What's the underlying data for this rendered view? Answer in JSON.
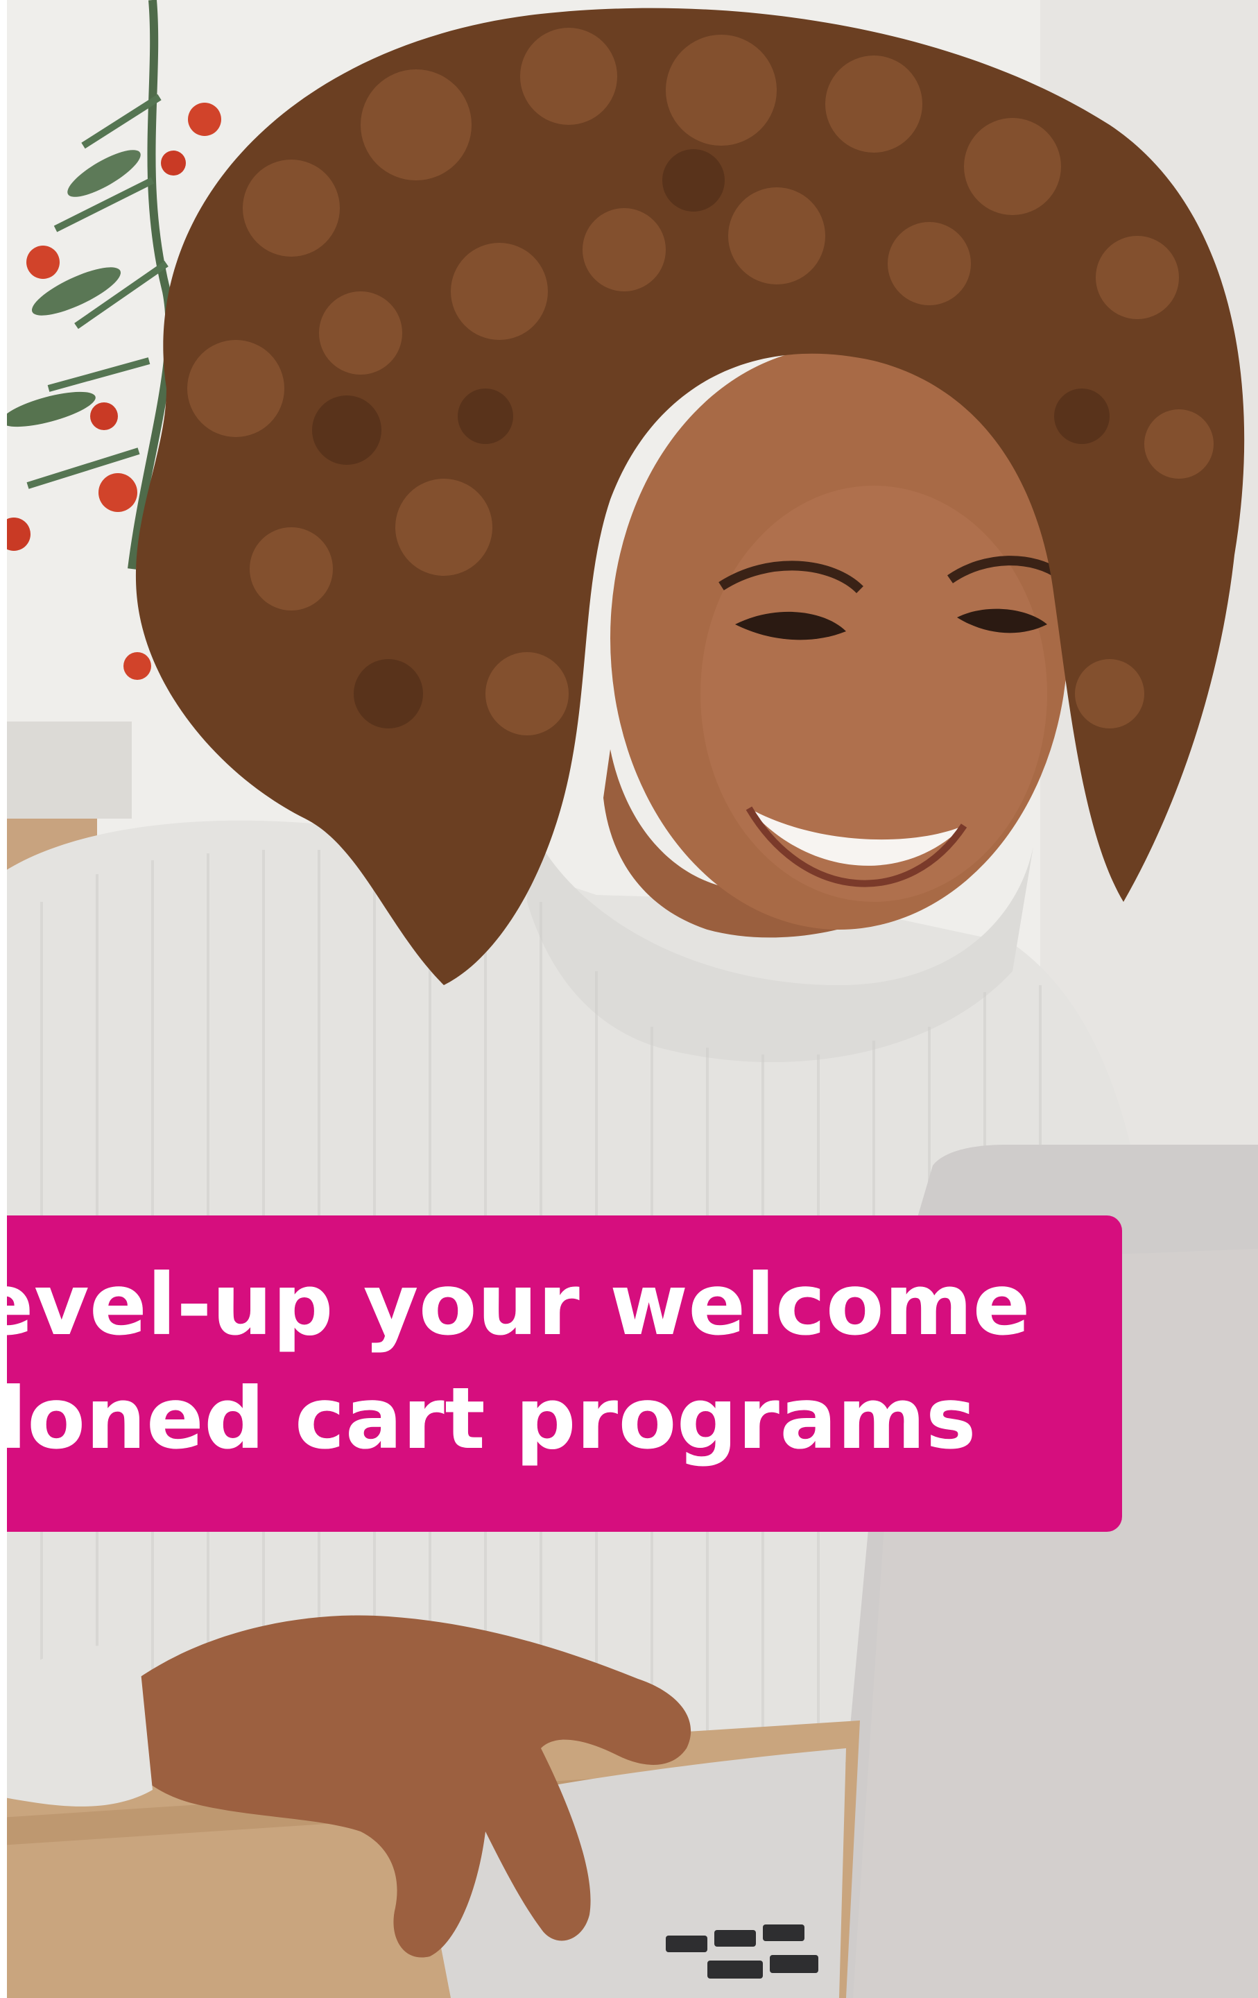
{
  "banner": {
    "line_1": "level-up your welcome",
    "line_2": "ndoned cart programs",
    "color": "#d60e7e"
  },
  "photo": {
    "subject": "smiling woman with curly hair in white turtleneck sweater using a laptop",
    "colors": {
      "sweater": "#e4e3e0",
      "hair": "#6b3f22",
      "skin": "#a86a46",
      "laptop": "#c9c6c4",
      "desk": "#c9a57e",
      "berries": "#d1432a",
      "foliage": "#4f6b4a"
    }
  }
}
